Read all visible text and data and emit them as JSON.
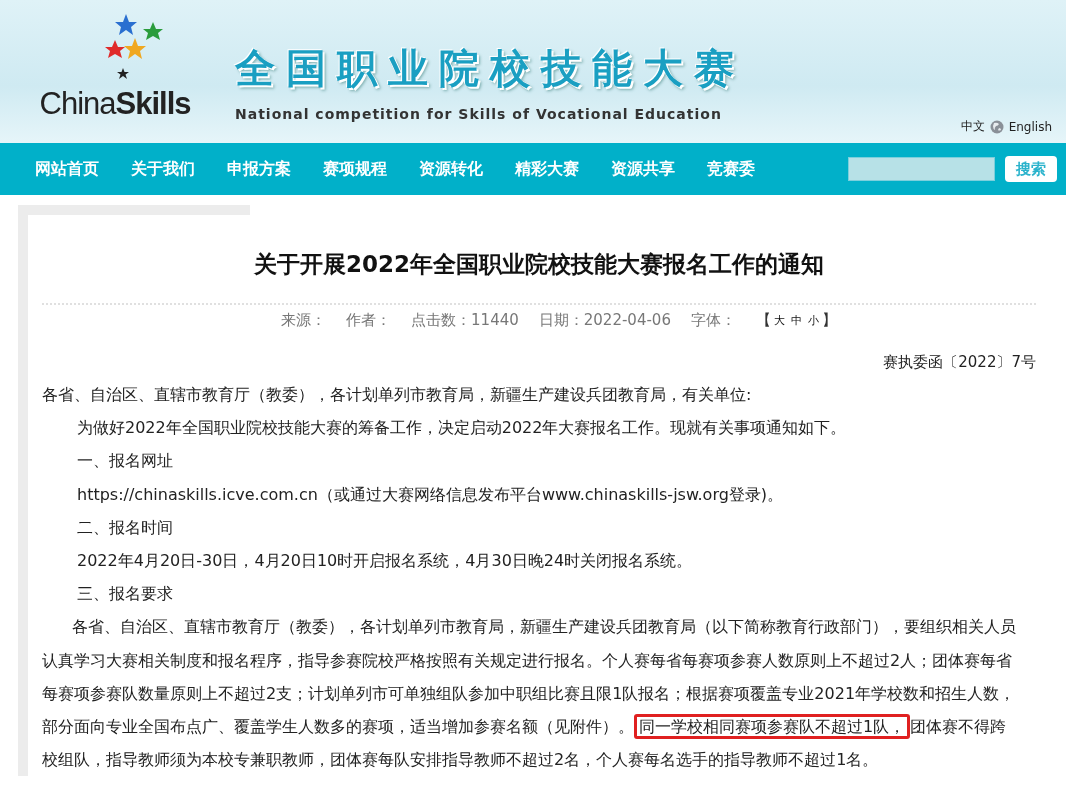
{
  "header": {
    "logo_text": {
      "plain": "China",
      "bold": "Skills"
    },
    "title": "全国职业院校技能大赛",
    "subtitle": "National competition for Skills of Vocational Education",
    "languages": [
      {
        "label": "中文"
      },
      {
        "label": "English"
      }
    ]
  },
  "nav": {
    "items": [
      {
        "label": "网站首页"
      },
      {
        "label": "关于我们"
      },
      {
        "label": "申报方案"
      },
      {
        "label": "赛项规程"
      },
      {
        "label": "资源转化"
      },
      {
        "label": "精彩大赛"
      },
      {
        "label": "资源共享"
      },
      {
        "label": "竞赛委"
      }
    ],
    "search_button": "搜索"
  },
  "article": {
    "title": "关于开展2022年全国职业院校技能大赛报名工作的通知",
    "meta": [
      {
        "label": "来源："
      },
      {
        "label": "作者："
      },
      {
        "label": "点击数：11440"
      },
      {
        "label": "日期：2022-04-06"
      },
      {
        "label": "字体："
      }
    ],
    "font_sizes": {
      "open": "【",
      "options": [
        "大",
        "中",
        "小"
      ],
      "close": "】"
    },
    "ref_number": "赛执委函〔2022〕7号",
    "paragraphs": [
      {
        "kind": "salutation",
        "segments": [
          {
            "text": "各省、自治区、直辖市教育厅（教委），各计划单列市教育局，新疆生产建设兵团教育局，有关单位:",
            "highlighted": false
          }
        ]
      },
      {
        "kind": "indent",
        "segments": [
          {
            "text": "为做好2022年全国职业院校技能大赛的筹备工作，决定启动2022年大赛报名工作。现就有关事项通知如下。",
            "highlighted": false
          }
        ]
      },
      {
        "kind": "heading",
        "segments": [
          {
            "text": "一、报名网址",
            "highlighted": false
          }
        ]
      },
      {
        "kind": "heading",
        "segments": [
          {
            "text": "https://chinaskills.icve.com.cn（或通过大赛网络信息发布平台www.chinaskills-jsw.org登录)。",
            "highlighted": false
          }
        ]
      },
      {
        "kind": "heading",
        "segments": [
          {
            "text": "二、报名时间",
            "highlighted": false
          }
        ]
      },
      {
        "kind": "heading",
        "segments": [
          {
            "text": "2022年4月20日-30日，4月20日10时开启报名系统，4月30日晚24时关闭报名系统。",
            "highlighted": false
          }
        ]
      },
      {
        "kind": "heading",
        "segments": [
          {
            "text": "三、报名要求",
            "highlighted": false
          }
        ]
      },
      {
        "kind": "body",
        "segments": [
          {
            "text": "各省、自治区、直辖市教育厅（教委），各计划单列市教育局，新疆生产建设兵团教育局（以下简称教育行政部门），要组织相关人员认真学习大赛相关制度和报名程序，指导参赛院校严格按照有关规定进行报名。个人赛每省每赛项参赛人数原则上不超过2人；团体赛每省每赛项参赛队数量原则上不超过2支；计划单列市可单独组队参加中职组比赛且限1队报名；根据赛项覆盖专业2021年学校数和招生人数，部分面向专业全国布点广、覆盖学生人数多的赛项，适当增加参赛名额（见附件）。",
            "highlighted": false
          },
          {
            "text": "同一学校相同赛项参赛队不超过1队，",
            "highlighted": true
          },
          {
            "text": "团体赛不得跨校组队，指导教师须为本校专兼职教师，团体赛每队安排指导教师不超过2名，个人赛每名选手的指导教师不超过1名。",
            "highlighted": false
          }
        ]
      }
    ]
  }
}
